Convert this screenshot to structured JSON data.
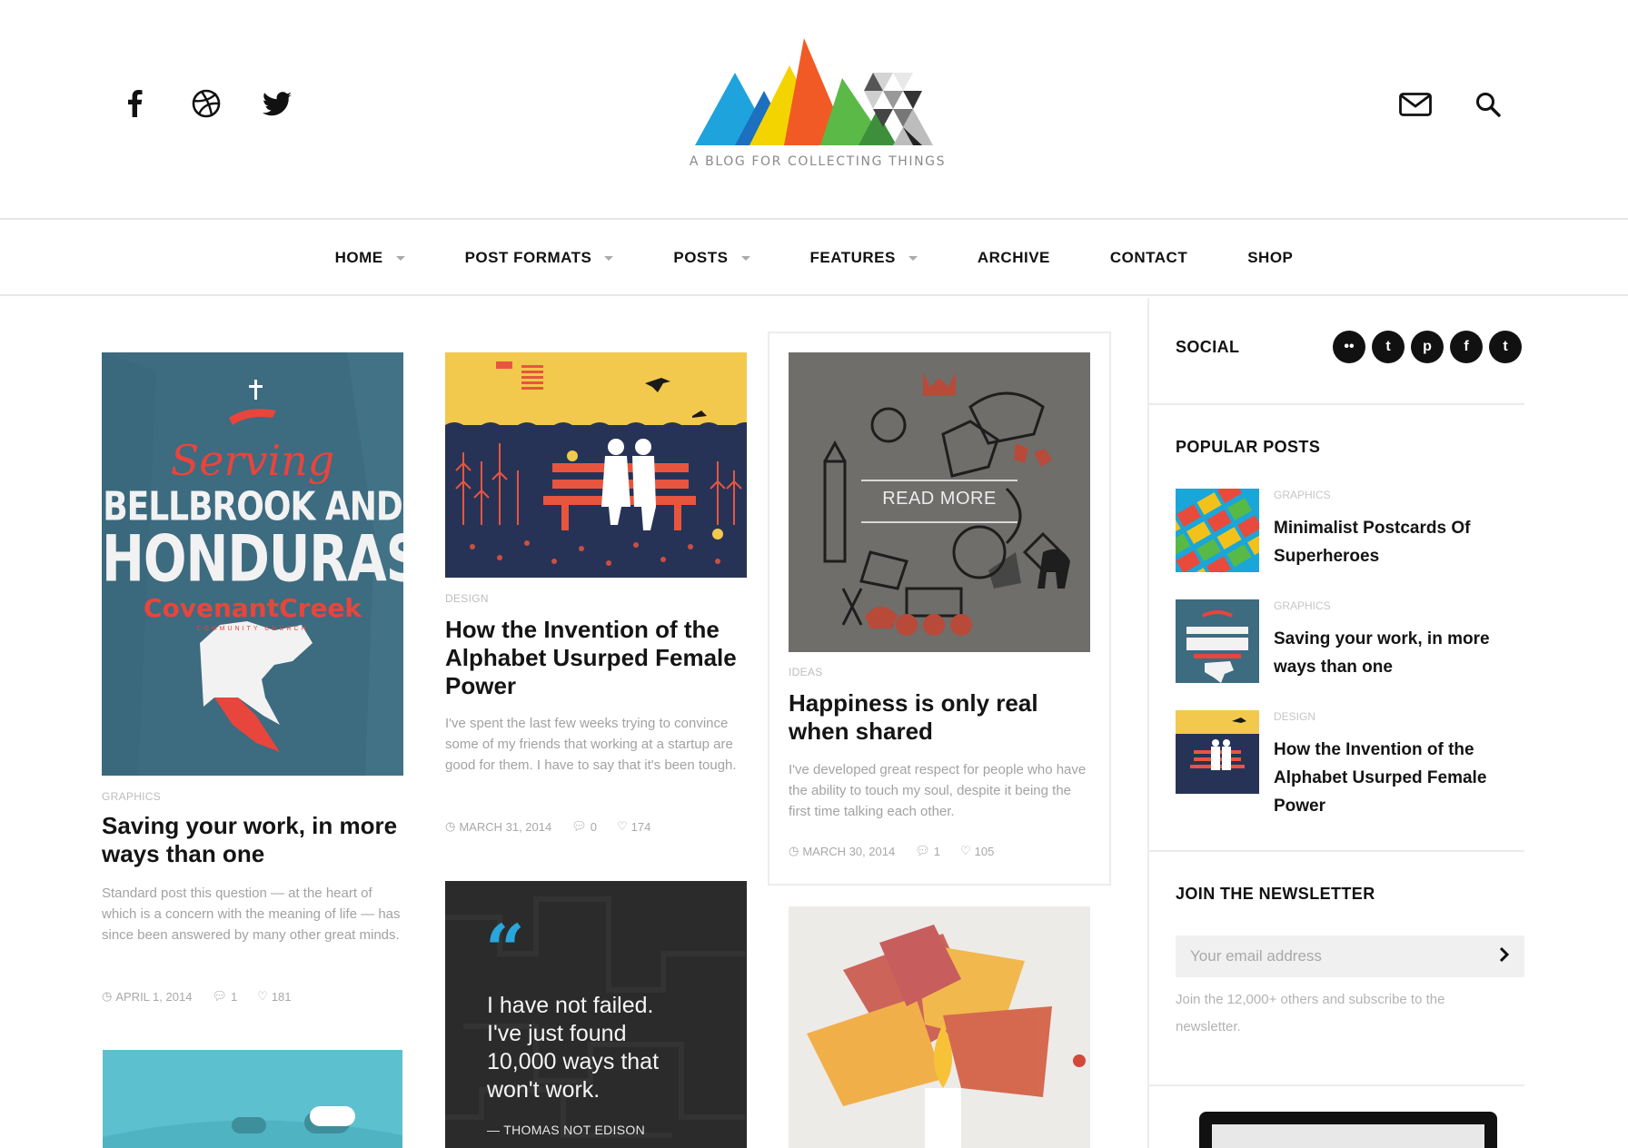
{
  "header": {
    "tagline": "A BLOG FOR COLLECTING THINGS",
    "social_icons": [
      "facebook-icon",
      "dribbble-icon",
      "twitter-icon"
    ],
    "right_icons": [
      "mail-icon",
      "search-icon"
    ]
  },
  "nav": {
    "items": [
      {
        "label": "HOME",
        "dropdown": true
      },
      {
        "label": "POST FORMATS",
        "dropdown": true
      },
      {
        "label": "POSTS",
        "dropdown": true
      },
      {
        "label": "FEATURES",
        "dropdown": true
      },
      {
        "label": "ARCHIVE",
        "dropdown": false
      },
      {
        "label": "CONTACT",
        "dropdown": false
      },
      {
        "label": "SHOP",
        "dropdown": false
      }
    ]
  },
  "posts": [
    {
      "image_text": {
        "top": "Serving",
        "line1": "BELLBROOK AND",
        "line2": "HONDURAS",
        "line3": "CovenantCreek",
        "line4": "COMMUNITY CHURCH"
      },
      "category": "GRAPHICS",
      "title": "Saving your work, in more ways than one",
      "excerpt": "Standard post this question — at the heart of which is a concern with the meaning of life — has since been answered by many other great minds.",
      "date": "APRIL 1, 2014",
      "comments": "1",
      "likes": "181"
    },
    {
      "category": "DESIGN",
      "title": "How the Invention of the Alphabet Usurped Female Power",
      "excerpt": "I've spent the last few weeks trying to convince some of my friends that working at a startup are good for them. I have to say that it's been tough.",
      "date": "MARCH 31, 2014",
      "comments": "0",
      "likes": "174"
    },
    {
      "overlay": "READ MORE",
      "category": "IDEAS",
      "title": "Happiness is only real when shared",
      "excerpt": "I've developed great respect for people who have the ability to touch my soul, despite it being the first time talking each other.",
      "date": "MARCH 30, 2014",
      "comments": "1",
      "likes": "105"
    }
  ],
  "quote": {
    "mark": "“",
    "text_lines": [
      "I have not failed.",
      "I've just found",
      "10,000 ways that",
      "won't work."
    ],
    "author": "— THOMAS NOT EDISON"
  },
  "sidebar": {
    "social_heading": "SOCIAL",
    "social_circles": [
      "flickr-icon",
      "tumblr-icon",
      "pinterest-icon",
      "facebook-icon",
      "twitter-icon"
    ],
    "social_glyphs": [
      "••",
      "t",
      "p",
      "f",
      "t"
    ],
    "popular_heading": "POPULAR POSTS",
    "popular": [
      {
        "category": "GRAPHICS",
        "title": "Minimalist Postcards Of Superheroes"
      },
      {
        "category": "GRAPHICS",
        "title": "Saving your work, in more ways than one"
      },
      {
        "category": "DESIGN",
        "title": "How the Invention of the Alphabet Usurped Female Power"
      }
    ],
    "newsletter_heading": "JOIN THE NEWSLETTER",
    "email_placeholder": "Your email address",
    "newsletter_text": "Join the 12,000+ others and subscribe to the newsletter."
  }
}
